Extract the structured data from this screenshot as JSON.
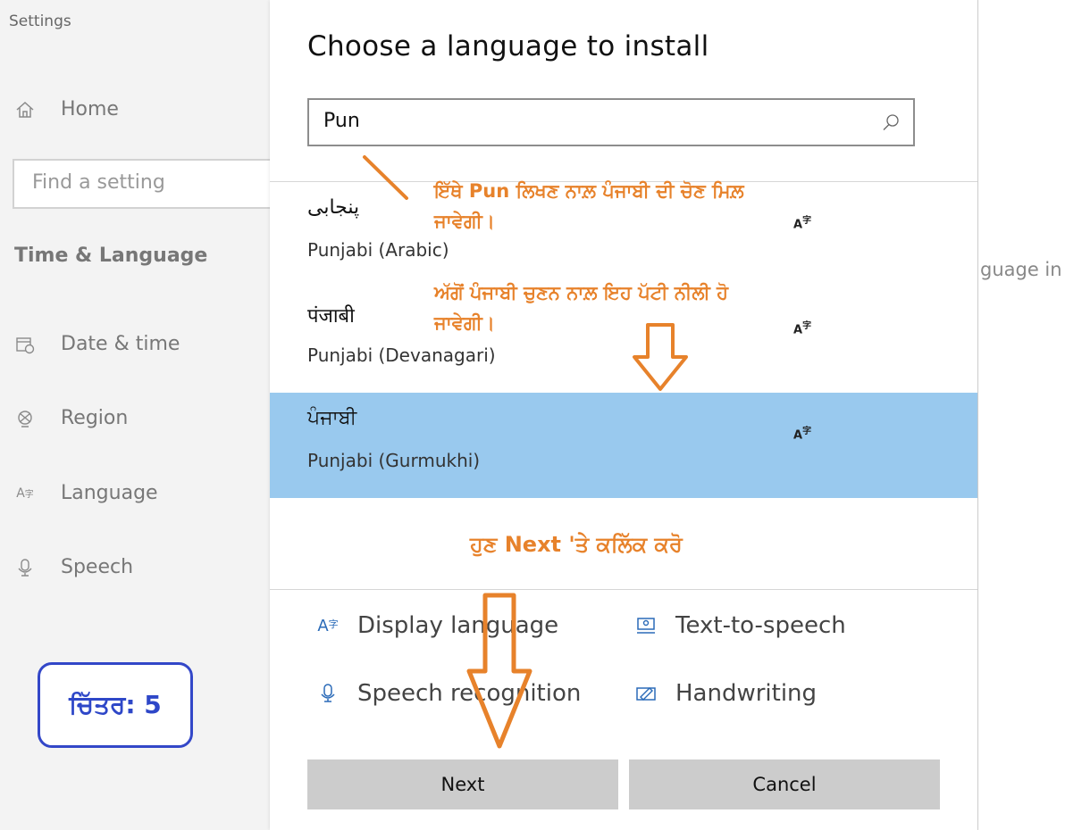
{
  "settings": {
    "title": "Settings",
    "home_label": "Home",
    "search_placeholder": "Find a setting",
    "section_label": "Time & Language",
    "nav": [
      {
        "label": "Date & time",
        "icon": "calendar-clock-icon"
      },
      {
        "label": "Region",
        "icon": "globe-icon"
      },
      {
        "label": "Language",
        "icon": "language-icon"
      },
      {
        "label": "Speech",
        "icon": "microphone-icon"
      }
    ],
    "right_fragment": "guage in"
  },
  "dialog": {
    "title": "Choose a language to install",
    "search_value": "Pun",
    "languages": [
      {
        "native": "پنجابی",
        "english": "Punjabi (Arabic)",
        "selected": false
      },
      {
        "native": "पंजाबी",
        "english": "Punjabi (Devanagari)",
        "selected": false
      },
      {
        "native": "ਪੰਜਾਬੀ",
        "english": "Punjabi (Gurmukhi)",
        "selected": true
      }
    ],
    "features": [
      {
        "label": "Display language",
        "icon": "language-icon"
      },
      {
        "label": "Text-to-speech",
        "icon": "text-to-speech-icon"
      },
      {
        "label": "Speech recognition",
        "icon": "microphone-icon"
      },
      {
        "label": "Handwriting",
        "icon": "handwriting-icon"
      }
    ],
    "next_label": "Next",
    "cancel_label": "Cancel"
  },
  "annotations": {
    "search_note": "ਇੱਥੇ Pun ਲਿਖਣ ਨਾਲ਼ ਪੰਜਾਬੀ ਦੀ ਚੋਣ ਮਿਲ਼ ਜਾਵੇਗੀ।",
    "select_note": "ਅੱਗੋਂ ਪੰਜਾਬੀ ਚੁਣਨ ਨਾਲ਼ ਇਹ ਪੱਟੀ ਨੀਲੀ ਹੋ ਜਾਵੇਗੀ।",
    "next_note": "ਹੁਣ Next 'ਤੇ ਕਲਿੱਕ ਕਰੋ",
    "figure_label": "ਚਿੱਤਰ: 5",
    "annotation_color": "#e7822b",
    "figure_border_color": "#3347c8",
    "selected_row_color": "#99c9ee"
  }
}
